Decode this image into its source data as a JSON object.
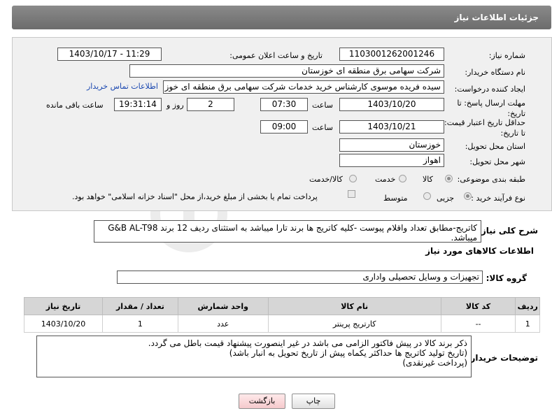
{
  "header": {
    "title": "جزئیات اطلاعات نیاز"
  },
  "form": {
    "need_number_label": "شماره نیاز:",
    "need_number": "1103001262001246",
    "announce_label": "تاریخ و ساعت اعلان عمومی:",
    "announce_value": "1403/10/17 - 11:29",
    "buyer_label": "نام دستگاه خریدار:",
    "buyer_value": "شرکت سهامی برق منطقه ای خوزستان",
    "creator_label": "ایجاد کننده درخواست:",
    "creator_value": "سیده فریده موسوی کارشناس خرید خدمات شرکت سهامی برق منطقه ای خوز",
    "contact_link": "اطلاعات تماس خریدار",
    "deadline_label": "مهلت ارسال پاسخ: تا تاریخ:",
    "deadline_date": "1403/10/20",
    "time_label": "ساعت",
    "deadline_time": "07:30",
    "days_value": "2",
    "days_label": "روز و",
    "remaining_value": "19:31:14",
    "remaining_label": "ساعت باقی مانده",
    "price_valid_label": "حداقل تاریخ اعتبار قیمت: تا تاریخ:",
    "price_valid_date": "1403/10/21",
    "price_valid_time": "09:00",
    "province_label": "استان محل تحویل:",
    "province_value": "خوزستان",
    "city_label": "شهر محل تحویل:",
    "city_value": "اهواز",
    "category_label": "طبقه بندی موضوعی:",
    "category_options": [
      "کالا",
      "خدمت",
      "کالا/خدمت"
    ],
    "category_selected": 0,
    "process_label": "نوع فرآیند خرید :",
    "process_options": [
      "جزیی",
      "متوسط"
    ],
    "process_selected": 0,
    "payment_text": "پرداخت تمام یا بخشی از مبلغ خرید،از محل \"اسناد خزانه اسلامی\" خواهد بود."
  },
  "summary": {
    "label": "شرح کلی نیاز:",
    "text": "کاتریج-مطابق تعداد واقلام پیوست -کلیه کاتریج ها برند تارا میباشد به استثنای ردیف 12 برند G&B AL-T98 میباشد."
  },
  "goods": {
    "section_title": "اطلاعات کالاهای مورد نیاز",
    "group_label": "گروه کالا:",
    "group_value": "تجهیزات و وسایل تحصیلی واداری",
    "columns": [
      "ردیف",
      "کد کالا",
      "نام کالا",
      "واحد شمارش",
      "تعداد / مقدار",
      "تاریخ نیاز"
    ],
    "rows": [
      [
        "1",
        "--",
        "کارتریج پرینتر",
        "عدد",
        "1",
        "1403/10/20"
      ]
    ]
  },
  "buyer_notes": {
    "label": "توضیحات خریدار:",
    "lines": [
      "ذکر برند کالا در پیش فاکتور الزامی می باشد در غیر اینصورت پیشنهاد قیمت باطل می گردد.",
      "(تاریخ تولید کاتریج ها حداکثر یکماه پیش از تاریخ تحویل به انبار باشد)",
      "(پرداخت غیرنقدی)"
    ]
  },
  "buttons": {
    "print": "چاپ",
    "back": "بازگشت"
  },
  "colors": {
    "header_bg": "#7a7a7a",
    "link": "#1a47b0",
    "back_button": "#f5c9cc"
  }
}
